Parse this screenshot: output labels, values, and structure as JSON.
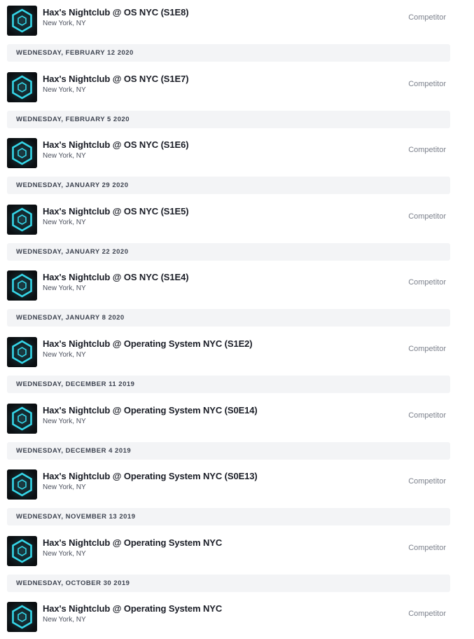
{
  "role_label": "Competitor",
  "thumbnail_icon": "hexagon-logo-icon",
  "accent_color": "#35d6e8",
  "events": [
    {
      "title": "Hax's Nightclub @ OS NYC (S1E8)",
      "location": "New York, NY",
      "date_after": "WEDNESDAY, FEBRUARY 12 2020"
    },
    {
      "title": "Hax's Nightclub @ OS NYC (S1E7)",
      "location": "New York, NY",
      "date_after": "WEDNESDAY, FEBRUARY 5 2020"
    },
    {
      "title": "Hax's Nightclub @ OS NYC (S1E6)",
      "location": "New York, NY",
      "date_after": "WEDNESDAY, JANUARY 29 2020"
    },
    {
      "title": "Hax's Nightclub @ OS NYC (S1E5)",
      "location": "New York, NY",
      "date_after": "WEDNESDAY, JANUARY 22 2020"
    },
    {
      "title": "Hax's Nightclub @ OS NYC (S1E4)",
      "location": "New York, NY",
      "date_after": "WEDNESDAY, JANUARY 8 2020"
    },
    {
      "title": "Hax's Nightclub @ Operating System NYC (S1E2)",
      "location": "New York, NY",
      "date_after": "WEDNESDAY, DECEMBER 11 2019"
    },
    {
      "title": "Hax's Nightclub @ Operating System NYC (S0E14)",
      "location": "New York, NY",
      "date_after": "WEDNESDAY, DECEMBER 4 2019"
    },
    {
      "title": "Hax's Nightclub @ Operating System NYC (S0E13)",
      "location": "New York, NY",
      "date_after": "WEDNESDAY, NOVEMBER 13 2019"
    },
    {
      "title": "Hax's Nightclub @ Operating System NYC",
      "location": "New York, NY",
      "date_after": "WEDNESDAY, OCTOBER 30 2019"
    },
    {
      "title": "Hax's Nightclub @ Operating System NYC",
      "location": "New York, NY",
      "date_after": ""
    }
  ]
}
